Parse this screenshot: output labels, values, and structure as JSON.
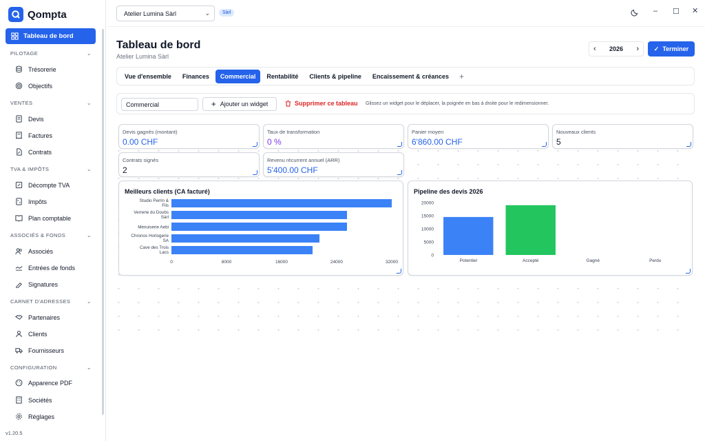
{
  "app": {
    "name": "Qompta",
    "version": "v1.20.5"
  },
  "sidebar": {
    "active": {
      "label": "Tableau de bord",
      "icon": "dashboard-icon"
    },
    "sections": [
      {
        "title": "PILOTAGE",
        "items": [
          {
            "label": "Trésorerie",
            "icon": "treasury-icon"
          },
          {
            "label": "Objectifs",
            "icon": "target-icon"
          }
        ]
      },
      {
        "title": "VENTES",
        "items": [
          {
            "label": "Devis",
            "icon": "quote-icon"
          },
          {
            "label": "Factures",
            "icon": "invoice-icon"
          },
          {
            "label": "Contrats",
            "icon": "contract-icon"
          }
        ]
      },
      {
        "title": "TVA & IMPÔTS",
        "items": [
          {
            "label": "Décompte TVA",
            "icon": "vat-icon"
          },
          {
            "label": "Impôts",
            "icon": "tax-icon"
          },
          {
            "label": "Plan comptable",
            "icon": "ledger-icon"
          }
        ]
      },
      {
        "title": "ASSOCIÉS & FONDS",
        "items": [
          {
            "label": "Associés",
            "icon": "partners-icon"
          },
          {
            "label": "Entrées de fonds",
            "icon": "funds-icon"
          },
          {
            "label": "Signatures",
            "icon": "signature-icon"
          }
        ]
      },
      {
        "title": "CARNET D'ADRESSES",
        "items": [
          {
            "label": "Partenaires",
            "icon": "handshake-icon"
          },
          {
            "label": "Clients",
            "icon": "user-icon"
          },
          {
            "label": "Fournisseurs",
            "icon": "supplier-icon"
          }
        ]
      },
      {
        "title": "CONFIGURATION",
        "items": [
          {
            "label": "Apparence PDF",
            "icon": "palette-icon"
          },
          {
            "label": "Sociétés",
            "icon": "building-icon"
          },
          {
            "label": "Réglages",
            "icon": "gear-icon"
          }
        ]
      }
    ]
  },
  "topbar": {
    "company": "Atelier Lumina Sàrl",
    "company_type": "Sàrl"
  },
  "page": {
    "title": "Tableau de bord",
    "subtitle": "Atelier Lumina Sàrl",
    "year": "2026",
    "finish_label": "Terminer"
  },
  "tabs": [
    "Vue d'ensemble",
    "Finances",
    "Commercial",
    "Rentabilité",
    "Clients & pipeline",
    "Encaissement & créances"
  ],
  "active_tab": "Commercial",
  "toolbar": {
    "dashboard_name": "Commercial",
    "add_widget": "Ajouter un widget",
    "delete_board": "Supprimer ce tableau",
    "hint": "Glissez un widget pour le déplacer, la poignée en bas à droite pour le redimensionner."
  },
  "kpis": [
    {
      "label": "Devis gagnés (montant)",
      "value": "0.00 CHF",
      "color": "#2563eb"
    },
    {
      "label": "Taux de transformation",
      "value": "0 %",
      "color": "#7c3aed"
    },
    {
      "label": "Panier moyen",
      "value": "6'860.00 CHF",
      "color": "#2563eb"
    },
    {
      "label": "Nouveaux clients",
      "value": "5",
      "color": "#111827"
    },
    {
      "label": "Contrats signés",
      "value": "2",
      "color": "#111827"
    },
    {
      "label": "Revenu récurrent annuel (ARR)",
      "value": "5'400.00 CHF",
      "color": "#2563eb"
    }
  ],
  "chart_data": [
    {
      "type": "bar",
      "orientation": "horizontal",
      "title": "Meilleurs clients (CA facturé)",
      "categories": [
        "Studio Perrin & Fils",
        "Verrerie du Doubs Sàrl",
        "Menuiserie Aebi",
        "Chronos Horlogerie SA",
        "Cave des Trois Lacs"
      ],
      "values": [
        32000,
        25500,
        25500,
        21500,
        20500
      ],
      "xlim": [
        0,
        32000
      ],
      "ticks": [
        "0",
        "8000",
        "16000",
        "24000",
        "32000"
      ],
      "color": "#3b82f6"
    },
    {
      "type": "bar",
      "title": "Pipeline des devis 2026",
      "categories": [
        "Potentiel",
        "Accepté",
        "Gagné",
        "Perdu"
      ],
      "values": [
        14500,
        19000,
        0,
        0
      ],
      "colors": [
        "#3b82f6",
        "#22c55e",
        "#f59e0b",
        "#ef4444"
      ],
      "ylim": [
        0,
        20000
      ],
      "ticks": [
        "0",
        "5000",
        "10000",
        "15000",
        "20000"
      ]
    }
  ]
}
